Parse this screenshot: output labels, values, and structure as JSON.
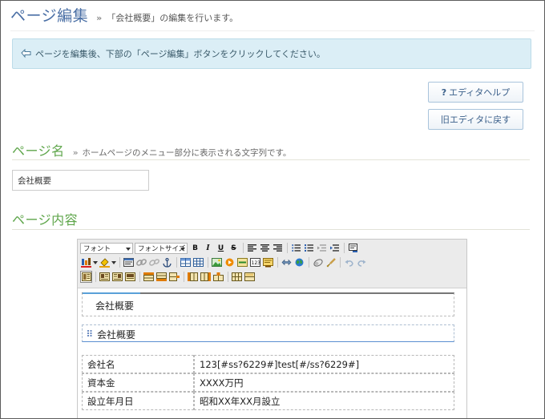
{
  "header": {
    "title": "ページ編集",
    "raquo": "»",
    "subtitle": "「会社概要」の編集を行います。"
  },
  "info": {
    "message": "ページを編集後、下部の「ページ編集」ボタンをクリックしてください。"
  },
  "buttons": {
    "help_icon": "?",
    "help_label": "エディタヘルプ",
    "old_editor_label": "旧エディタに戻す"
  },
  "page_name_section": {
    "title": "ページ名",
    "raquo": "»",
    "description": "ホームページのメニュー部分に表示される文字列です。",
    "input_value": "会社概要"
  },
  "content_section": {
    "title": "ページ内容"
  },
  "editor": {
    "font_select": "フォント",
    "font_size_select": "フォントサイズ",
    "bold": "B",
    "italic": "I",
    "underline": "U",
    "strike": "S",
    "block1_text": "会社概要",
    "block2_text": "会社概要",
    "table": [
      {
        "key": "会社名",
        "value": "123[#ss?6229#]test[#/ss?6229#]"
      },
      {
        "key": "資本金",
        "value": "XXXX万円"
      },
      {
        "key": "設立年月日",
        "value": "昭和XX年XX月設立"
      }
    ]
  },
  "colors": {
    "title_blue": "#4a6fa5",
    "section_green": "#5fa64b",
    "info_bg": "#dbeef6"
  }
}
